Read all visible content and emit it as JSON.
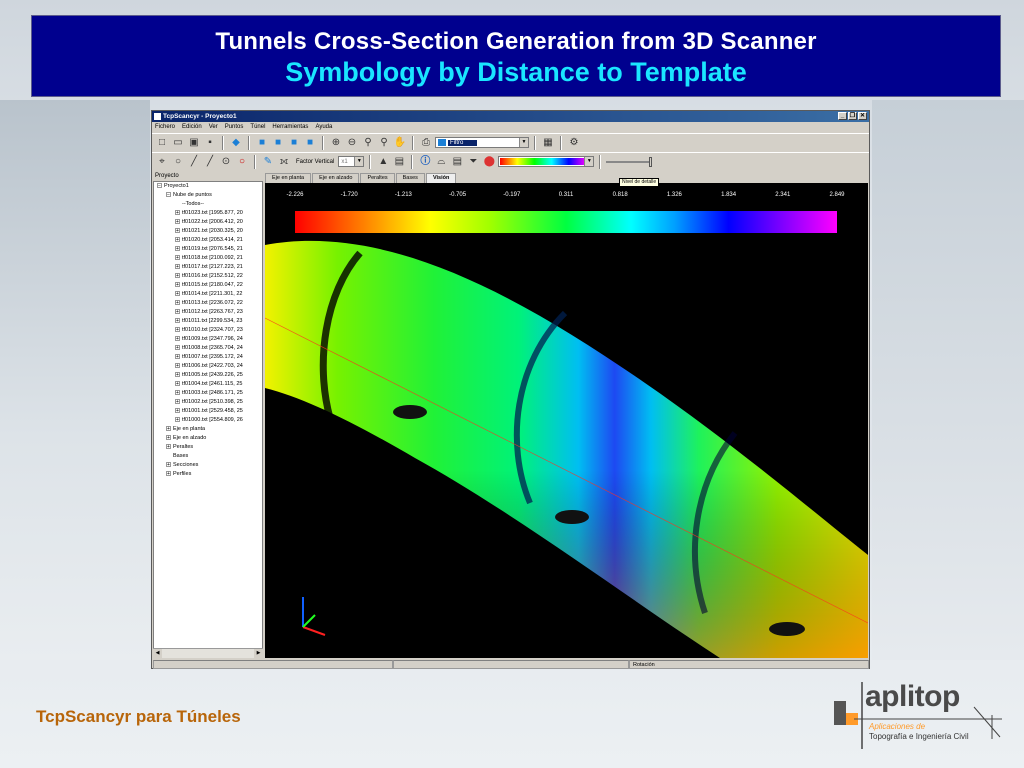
{
  "slide": {
    "title_line1": "Tunnels Cross-Section Generation from 3D Scanner",
    "title_line2": "Symbology by Distance to Template",
    "footer": "TcpScancyr para Túneles",
    "logo": {
      "word": "aplitop",
      "sub1": "Aplicaciones de",
      "sub2": "Topografía e Ingeniería Civil"
    }
  },
  "window": {
    "title": "TcpScancyr - Proyecto1",
    "controls": [
      "_",
      "❐",
      "✕"
    ]
  },
  "menu": [
    "Fichero",
    "Edición",
    "Ver",
    "Puntos",
    "Túnel",
    "Herramientas",
    "Ayuda"
  ],
  "toolbar": {
    "filter_label": "Filtro",
    "factor_label": "Factor Vertical",
    "factor_value": "x1"
  },
  "panel": {
    "label": "Proyecto",
    "tree": [
      {
        "label": "Proyecto1",
        "level": 0,
        "toggle": "−"
      },
      {
        "label": "Nube de puntos",
        "level": 1,
        "toggle": "−"
      },
      {
        "label": "--Todos--",
        "level": 2,
        "toggle": ""
      },
      {
        "label": "tf01023.txt [1995.877, 20",
        "level": 2,
        "toggle": "+"
      },
      {
        "label": "tf01022.txt [2006.412, 20",
        "level": 2,
        "toggle": "+"
      },
      {
        "label": "tf01021.txt [2030.325, 20",
        "level": 2,
        "toggle": "+"
      },
      {
        "label": "tf01020.txt [2053.414, 21",
        "level": 2,
        "toggle": "+"
      },
      {
        "label": "tf01019.txt [2076.545, 21",
        "level": 2,
        "toggle": "+"
      },
      {
        "label": "tf01018.txt [2100.092, 21",
        "level": 2,
        "toggle": "+"
      },
      {
        "label": "tf01017.txt [2127.223, 21",
        "level": 2,
        "toggle": "+"
      },
      {
        "label": "tf01016.txt [2152.512, 22",
        "level": 2,
        "toggle": "+"
      },
      {
        "label": "tf01015.txt [2180.047, 22",
        "level": 2,
        "toggle": "+"
      },
      {
        "label": "tf01014.txt [2211.301, 22",
        "level": 2,
        "toggle": "+"
      },
      {
        "label": "tf01013.txt [2236.072, 22",
        "level": 2,
        "toggle": "+"
      },
      {
        "label": "tf01012.txt [2263.767, 23",
        "level": 2,
        "toggle": "+"
      },
      {
        "label": "tf01011.txt [2299.534, 23",
        "level": 2,
        "toggle": "+"
      },
      {
        "label": "tf01010.txt [2324.707, 23",
        "level": 2,
        "toggle": "+"
      },
      {
        "label": "tf01009.txt [2347.796, 24",
        "level": 2,
        "toggle": "+"
      },
      {
        "label": "tf01008.txt [2365.704, 24",
        "level": 2,
        "toggle": "+"
      },
      {
        "label": "tf01007.txt [2395.172, 24",
        "level": 2,
        "toggle": "+"
      },
      {
        "label": "tf01006.txt [2422.703, 24",
        "level": 2,
        "toggle": "+"
      },
      {
        "label": "tf01005.txt [2439.226, 25",
        "level": 2,
        "toggle": "+"
      },
      {
        "label": "tf01004.txt [2461.115, 25",
        "level": 2,
        "toggle": "+"
      },
      {
        "label": "tf01003.txt [2486.171, 25",
        "level": 2,
        "toggle": "+"
      },
      {
        "label": "tf01002.txt [2510.398, 25",
        "level": 2,
        "toggle": "+"
      },
      {
        "label": "tf01001.txt [2529.458, 25",
        "level": 2,
        "toggle": "+"
      },
      {
        "label": "tf01000.txt [2554.809, 26",
        "level": 2,
        "toggle": "+"
      },
      {
        "label": "Eje en planta",
        "level": 1,
        "toggle": "+"
      },
      {
        "label": "Eje en alzado",
        "level": 1,
        "toggle": "+"
      },
      {
        "label": "Peraltes",
        "level": 1,
        "toggle": "+"
      },
      {
        "label": "Bases",
        "level": 1,
        "toggle": ""
      },
      {
        "label": "Secciones",
        "level": 1,
        "toggle": "+"
      },
      {
        "label": "Perfiles",
        "level": 1,
        "toggle": "+"
      }
    ]
  },
  "view": {
    "tabs": [
      "Eje en planta",
      "Eje en alzado",
      "Peraltes",
      "Bases",
      "Visión"
    ],
    "active_tab": "Visión",
    "tooltip": "Nivel de detalle",
    "scale_ticks": [
      "-2.226",
      "-1.720",
      "-1.213",
      "-0.705",
      "-0.197",
      "0.311",
      "0.818",
      "1.326",
      "1.834",
      "2.341",
      "2.849"
    ],
    "status_rotation": "Rotación"
  },
  "colors": {
    "banner_bg": "#00008e",
    "title_accent": "#1ae6ff",
    "footer_text": "#b8650a",
    "logo_accent": "#ff9a2a"
  }
}
